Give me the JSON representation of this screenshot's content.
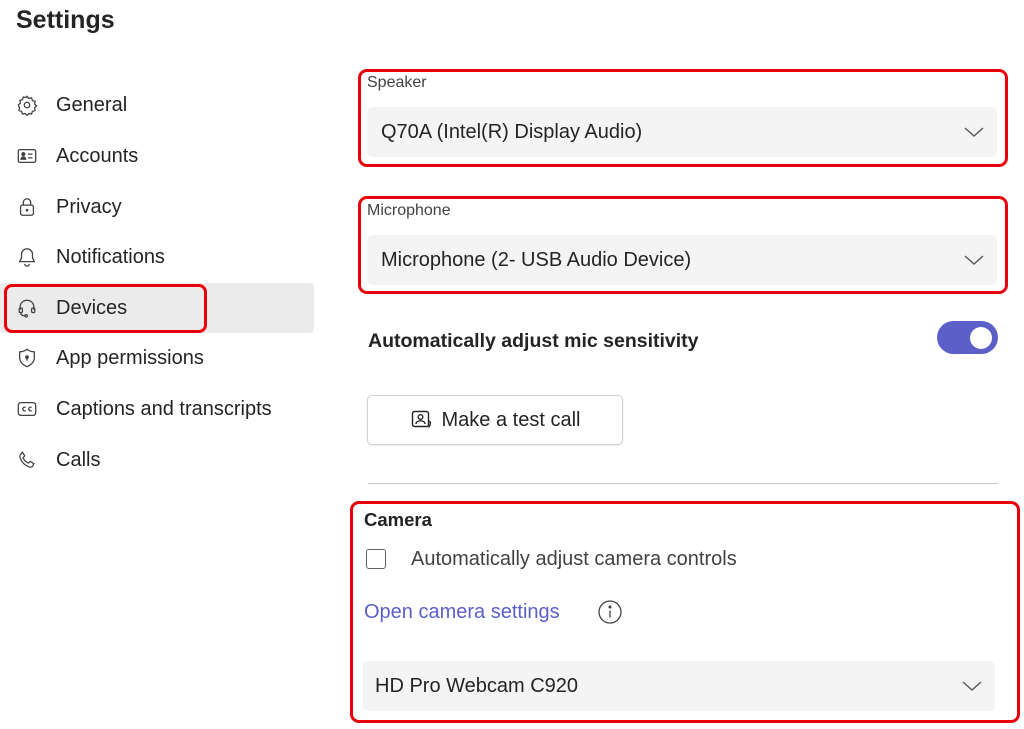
{
  "page": {
    "title": "Settings"
  },
  "sidebar": {
    "items": [
      {
        "label": "General",
        "icon": "gear-icon",
        "selected": false
      },
      {
        "label": "Accounts",
        "icon": "id-card-icon",
        "selected": false
      },
      {
        "label": "Privacy",
        "icon": "lock-icon",
        "selected": false
      },
      {
        "label": "Notifications",
        "icon": "bell-icon",
        "selected": false
      },
      {
        "label": "Devices",
        "icon": "headset-icon",
        "selected": true
      },
      {
        "label": "App permissions",
        "icon": "shield-icon",
        "selected": false
      },
      {
        "label": "Captions and transcripts",
        "icon": "closed-captions-icon",
        "selected": false
      },
      {
        "label": "Calls",
        "icon": "phone-icon",
        "selected": false
      }
    ]
  },
  "devices": {
    "speaker": {
      "label": "Speaker",
      "value": "Q70A (Intel(R) Display Audio)"
    },
    "microphone": {
      "label": "Microphone",
      "value": "Microphone (2- USB Audio Device)"
    },
    "mic_sensitivity": {
      "label": "Automatically adjust mic sensitivity",
      "enabled": true
    },
    "test_call": {
      "label": "Make a test call"
    },
    "camera": {
      "title": "Camera",
      "auto_adjust_label": "Automatically adjust camera controls",
      "auto_adjust_checked": false,
      "open_settings_link": "Open camera settings",
      "value": "HD Pro Webcam C920"
    }
  },
  "colors": {
    "accent": "#5b5fc7",
    "highlight": "#e8000a",
    "selected_bg": "#ebebeb"
  }
}
